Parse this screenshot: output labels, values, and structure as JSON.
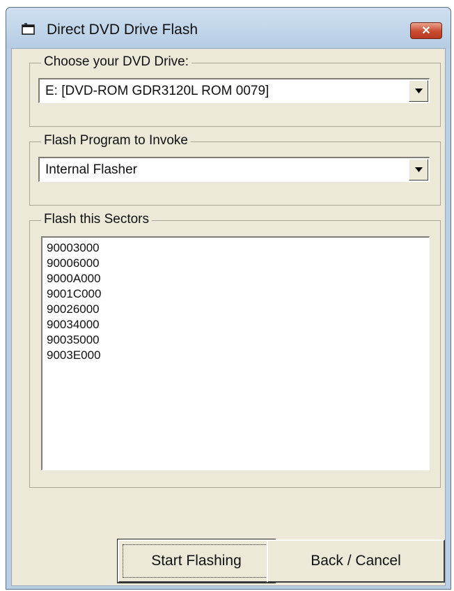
{
  "window": {
    "title": "Direct DVD Drive Flash",
    "close_label": "✕"
  },
  "drive_group": {
    "label": "Choose your DVD Drive:",
    "selected": "E: [DVD-ROM GDR3120L ROM 0079]"
  },
  "program_group": {
    "label": "Flash Program to Invoke",
    "selected": "Internal Flasher"
  },
  "sectors_group": {
    "label": "Flash this Sectors",
    "items": [
      "90003000",
      "90006000",
      "9000A000",
      "9001C000",
      "90026000",
      "90034000",
      "90035000",
      "9003E000"
    ]
  },
  "buttons": {
    "start": "Start Flashing",
    "back": "Back / Cancel"
  },
  "icons": {
    "title_icon": "window-app-icon",
    "close_icon": "close-icon",
    "dropdown_icon": "chevron-down-icon"
  },
  "colors": {
    "window_frame": "#b8cfe6",
    "dialog_face": "#ece9d8",
    "close_button": "#c94a30"
  }
}
